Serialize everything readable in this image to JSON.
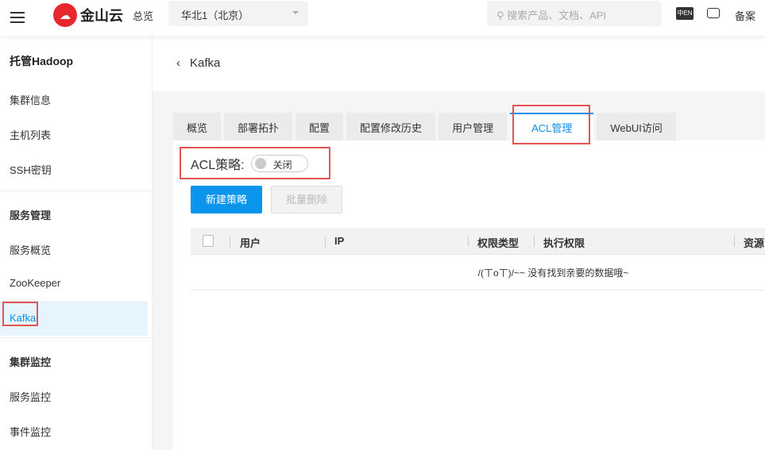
{
  "header": {
    "brand": "金山云",
    "overview": "总览",
    "region": "华北1（北京）",
    "search_placeholder": "搜索产品、文档、API",
    "lang": "中EN",
    "beian": "备案"
  },
  "sidebar": {
    "title": "托管Hadoop",
    "items": [
      "集群信息",
      "主机列表",
      "SSH密钥"
    ],
    "section2": "服务管理",
    "items2": [
      "服务概览",
      "ZooKeeper",
      "Kafka"
    ],
    "section3": "集群监控",
    "items3": [
      "服务监控",
      "事件监控"
    ]
  },
  "page": {
    "title": "Kafka"
  },
  "tabs": [
    "概览",
    "部署拓扑",
    "配置",
    "配置修改历史",
    "用户管理",
    "ACL管理",
    "WebUI访问"
  ],
  "acl": {
    "label": "ACL策略:",
    "toggle": "关闭"
  },
  "buttons": {
    "create": "新建策略",
    "batch_delete": "批量删除"
  },
  "table": {
    "columns": [
      "用户",
      "IP",
      "权限类型",
      "执行权限",
      "资源"
    ],
    "empty": "/(ㄒoㄒ)/~~ 没有找到亲要的数据哦~"
  }
}
